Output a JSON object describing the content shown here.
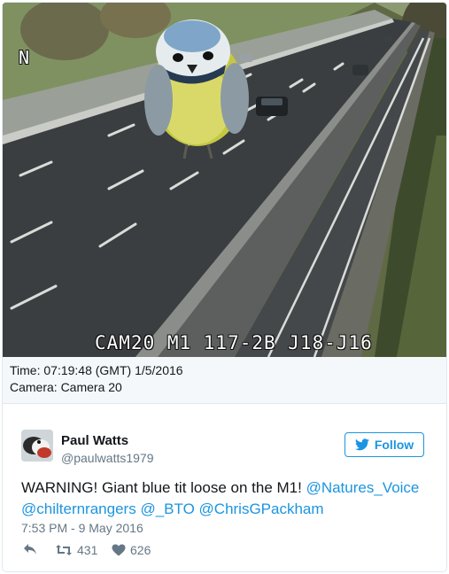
{
  "camera": {
    "compass": "N",
    "caption": "CAM20 M1 117-2B J18-J16"
  },
  "meta": {
    "time_line": "Time: 07:19:48 (GMT)  1/5/2016",
    "camera_line": "Camera: Camera 20"
  },
  "tweet": {
    "author_name": "Paul Watts",
    "author_handle": "@paulwatts1979",
    "follow_label": "Follow",
    "text_prefix": "WARNING! Giant blue tit loose on the M1! ",
    "mentions": [
      "@Natures_Voice",
      "@chilternrangers",
      "@_BTO",
      "@ChrisGPackham"
    ],
    "timestamp": "7:53 PM - 9 May 2016",
    "retweet_count": "431",
    "like_count": "626",
    "icons": {
      "reply": "reply-icon",
      "retweet": "retweet-icon",
      "like": "heart-icon",
      "follow": "twitter-bird-icon"
    },
    "colors": {
      "accent": "#1b95e0",
      "muted": "#657786",
      "text": "#14171a"
    }
  }
}
